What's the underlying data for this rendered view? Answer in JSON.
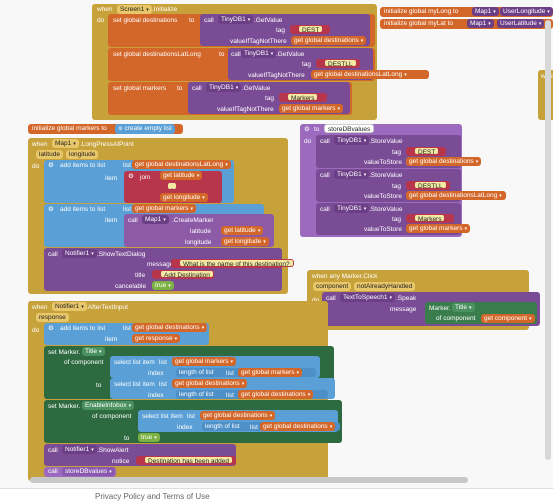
{
  "screen_init": {
    "when": "when",
    "comp": "Screen1",
    "event": ".Initialize",
    "do": "do",
    "rows": [
      {
        "set": "set global destinations",
        "to": "to",
        "call": "call",
        "db": "TinyDB1",
        "method": ".GetValue",
        "tag_label": "tag",
        "tag": "DEST",
        "ifnot_label": "valueIfTagNotThere",
        "ifnot": "get global destinations"
      },
      {
        "set": "set global destinationsLatLong",
        "to": "to",
        "call": "call",
        "db": "TinyDB1",
        "method": ".GetValue",
        "tag_label": "tag",
        "tag": "DESTLL",
        "ifnot_label": "valueIfTagNotThere",
        "ifnot": "get global destinationsLatLong"
      },
      {
        "set": "set global markers",
        "to": "to",
        "call": "call",
        "db": "TinyDB1",
        "method": ".GetValue",
        "tag_label": "tag",
        "tag": "Markers",
        "ifnot_label": "valueIfTagNotThere",
        "ifnot": "get global markers"
      }
    ]
  },
  "top_right": {
    "long_init": "initialize global myLong to",
    "long_comp": "Map1",
    "long_prop": "UserLongitude",
    "lat_init": "initialize global myLat to",
    "lat_comp": "Map1",
    "lat_prop": "UserLatitude",
    "partial": "whe"
  },
  "markers_init": {
    "label": "initialize global markers to",
    "value": "create empty list"
  },
  "store_proc": {
    "to": "to",
    "name": "storeDBvalues",
    "do": "do",
    "rows": [
      {
        "call": "call",
        "db": "TinyDB1",
        "method": ".StoreValue",
        "tag_label": "tag",
        "tag": "DEST",
        "val_label": "valueToStore",
        "val": "get global destinations"
      },
      {
        "call": "call",
        "db": "TinyDB1",
        "method": ".StoreValue",
        "tag_label": "tag",
        "tag": "DESTLL",
        "val_label": "valueToStore",
        "val": "get global destinationsLatLong"
      },
      {
        "call": "call",
        "db": "TinyDB1",
        "method": ".StoreValue",
        "tag_label": "tag",
        "tag": "Markers",
        "val_label": "valueToStore",
        "val": "get global markers"
      }
    ]
  },
  "long_press": {
    "when": "when",
    "comp": "Map1",
    "event": ".LongPressAtPoint",
    "p1": "latitude",
    "p2": "longitude",
    "do": "do",
    "add1": "add items to list",
    "list_label": "list",
    "list1": "get global destinationsLatLong",
    "item_label": "item",
    "join": "join",
    "get_lat": "get latitude",
    "comma": ",",
    "get_lon": "get longitude",
    "add2": "add items to list",
    "list2": "get global markers",
    "item2_call": "call",
    "item2_comp": "Map1",
    "item2_method": ".CreateMarker",
    "cm_lat_label": "latitude",
    "cm_lat": "get latitude",
    "cm_lon_label": "longitude",
    "cm_lon": "get longitude",
    "notifier_call": "call",
    "notifier": "Notifier1",
    "notifier_method": ".ShowTextDialog",
    "message_label": "message",
    "message": "What is the name of this destination?",
    "title_label": "title",
    "title": "Add Destination",
    "cancel_label": "cancelable",
    "cancel": "true"
  },
  "marker_click": {
    "when": "when any Marker.Click",
    "p1": "component",
    "p2": "notAlreadyHandled",
    "do": "do",
    "call": "call",
    "comp": "TextToSpeech1",
    "method": ".Speak",
    "msg_label": "message",
    "msg_comp": "Marker.",
    "msg_prop": "Title",
    "of_comp_label": "of component",
    "of_comp": "get component"
  },
  "after_text": {
    "when": "when",
    "comp": "Notifier1",
    "event": ".AfterTextInput",
    "p1": "response",
    "do": "do",
    "add": "add items to list",
    "list_label": "list",
    "list": "get global destinations",
    "item_label": "item",
    "item": "get response",
    "set1": "set Marker.",
    "set1_prop": "Title",
    "of_comp": "of component",
    "sel": "select list item",
    "sel_list_label": "list",
    "sel_list": "get global markers",
    "index_label": "index",
    "length": "length of list",
    "length_list_label": "list",
    "length_list": "get global markers",
    "to_label": "to",
    "sel2_list": "get global destinations",
    "length2_list": "get global destinations",
    "set2": "set Marker.",
    "set2_prop": "EnableInfobox",
    "sel3_list": "get global destinations",
    "length3_list": "get global destinations",
    "to2": "to",
    "true_val": "true",
    "alert_call": "call",
    "alert_comp": "Notifier1",
    "alert_method": ".ShowAlert",
    "notice_label": "notice",
    "notice": "Destination has been added",
    "store_call": "call",
    "store_name": "storeDBvalues"
  },
  "footer": {
    "text": "Privacy Policy and Terms of Use"
  }
}
